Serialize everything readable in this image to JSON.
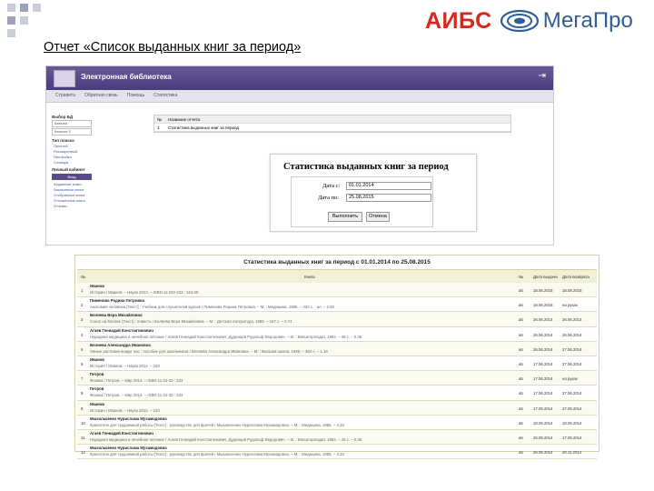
{
  "header": {
    "brand_main": "АИБС",
    "brand_product": "МегаПро",
    "slide_title": "Отчет «Список выданных книг за период»"
  },
  "colors": {
    "brand_red": "#d9251c",
    "brand_blue": "#2f5d97",
    "header_purple": "#4a3b7c"
  },
  "library_window": {
    "app_title": "Электронная библиотека",
    "nav_tabs": [
      "Стравита",
      "Обратная связь",
      "Помощь",
      "Статистика"
    ],
    "sidebar": {
      "db_label": "Выбор БД",
      "db_options": [
        "Каталог",
        "Каталог 2"
      ],
      "search_type_label": "Тип поиска",
      "search_types": [
        "Простой",
        "Расширенный",
        "Настройка",
        "Словари"
      ],
      "reader_label": "Личный кабинет",
      "reader_button": "Вход",
      "reader_menu": [
        "Выданные книги",
        "Заказанные книги",
        "Отобранные книги",
        "Отложенные книги",
        "Отзывы"
      ]
    },
    "report_list": {
      "col_num": "№",
      "col_name": "Название отчета",
      "rows": [
        {
          "num": "1",
          "name": "Статистика выданных книг за период"
        }
      ]
    }
  },
  "stat_form": {
    "title": "Статистика выданных книг за период",
    "date_from_label": "Дата с:",
    "date_from_value": "01.01.2014",
    "date_to_label": "Дата по:",
    "date_to_value": "25.08.2015",
    "run_button": "Выполнить",
    "cancel_button": "Отмена"
  },
  "report": {
    "title": "Статистика выданных книг за период с 01.01.2014 по 25.08.2015",
    "columns": [
      "№",
      "Книга",
      "№",
      "Дата выдачи",
      "Дата возврата"
    ],
    "rows": [
      {
        "num": "1",
        "line1": "Иванов",
        "line2": "История / Иванов. – Наука 2013. – ISBN 11-222-333 : 163.00",
        "code": "а5",
        "issued": "18.06.2015",
        "returned": "18.08.2015"
      },
      {
        "num": "2",
        "line1": "Пименова Родина Петровна",
        "line2": "Анатомия человека [Текст] : Учебник для слушателей курсов / Пименова Родина Петровна. – М. : Медицина, 1995. – 320 с. : ил. – 2.50",
        "code": "а6",
        "issued": "18.06.2015",
        "returned": "на руках"
      },
      {
        "num": "3",
        "line1": "Беляева Вера Михайловна",
        "line2": "Сокол на Москве [Текст] : повесть / Беляева Вера Михайловна. – М. : Детская литература, 1985. – 157 с. – 0.74",
        "code": "а5",
        "issued": "26.06.2014",
        "returned": "26.06.2014"
      },
      {
        "num": "4",
        "line1": "Агаев Геннадий Константинович",
        "line2": "Народная медицина и лечебное питание / Агаев Геннадий Константинович, Дуданцев Рудольф Федорович. – М. : Внешторгиздат, 1992. – 46 с. – 0.35",
        "code": "а6",
        "issued": "26.06.2014",
        "returned": "26.06.2014"
      },
      {
        "num": "5",
        "line1": "Беляева Александра Ивановна",
        "line2": "Умные растения вокруг нас : пособие для школьников / Беляева Александра Ивановна. – М. : Высшая школа, 1988. – 384 с. – 1.18",
        "code": "а6",
        "issued": "26.06.2014",
        "returned": "27.06.2014"
      },
      {
        "num": "6",
        "line1": "Иванов",
        "line2": "История / Иванов. – Наука 2014. – 233",
        "code": "а5",
        "issued": "17.06.2014",
        "returned": "27.06.2014"
      },
      {
        "num": "7",
        "line1": "Петров",
        "line2": "Физика / Петров. – Мир 2014. – ISBN 11-22-33 : 233",
        "code": "а5",
        "issued": "17.06.2014",
        "returned": "на руках"
      },
      {
        "num": "8",
        "line1": "Петров",
        "line2": "Физика / Петров. – Мир 2014. – ISBN 11-22-33 : 233",
        "code": "а5",
        "issued": "17.06.2014",
        "returned": "27.06.2014"
      },
      {
        "num": "9",
        "line1": "Иванов",
        "line2": "История / Иванов. – Наука 2014. – 233",
        "code": "а5",
        "issued": "17.06.2014",
        "returned": "27.06.2014"
      },
      {
        "num": "10",
        "line1": "Мыхальченко Нурислама Мухамадовна",
        "line2": "Красители для трудоемкой работы [Текст] : руководство для врачей / Мыхальченко Нурислама Мухамадовна. – М. : Медицина, 1985. – 2.10",
        "code": "а5",
        "issued": "18.06.2014",
        "returned": "18.06.2014"
      },
      {
        "num": "11",
        "line1": "Агаев Геннадий Константинович",
        "line2": "Народная медицина и лечебное питание / Агаев Геннадий Константинович, Дуданцев Рудольф Федорович. – М. : Внешторгиздат, 1992. – 46 с. – 0.35",
        "code": "а6",
        "issued": "26.05.2014",
        "returned": "17.06.2014"
      },
      {
        "num": "12",
        "line1": "Мыхальченко Нурислама Мухамадовна",
        "line2": "Красители для трудоемкой работы [Текст] : руководство для врачей / Мыхальченко Нурислама Мухамадовна. – М. : Медицина, 1985. – 2.10",
        "code": "а5",
        "issued": "26.06.2014",
        "returned": "20.11.2014"
      }
    ]
  }
}
